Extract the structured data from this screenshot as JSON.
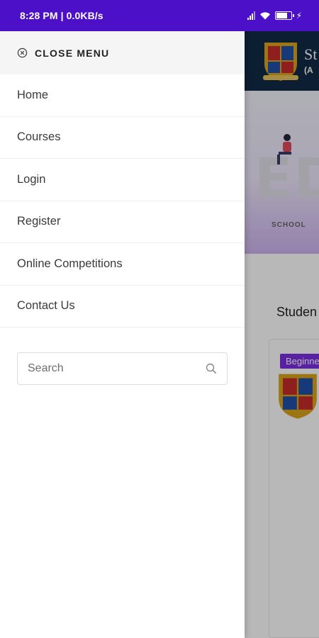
{
  "status_bar": {
    "time_text": "8:28 PM | 0.0KB/s",
    "battery_icon": "battery-charging-icon",
    "signal_icon": "signal-icon",
    "wifi_icon": "wifi-icon"
  },
  "drawer": {
    "close_label": "CLOSE MENU",
    "close_icon": "close-circle-icon",
    "items": [
      {
        "label": "Home"
      },
      {
        "label": "Courses"
      },
      {
        "label": "Login"
      },
      {
        "label": "Register"
      },
      {
        "label": "Online Competitions"
      },
      {
        "label": "Contact Us"
      }
    ],
    "search": {
      "placeholder": "Search",
      "icon": "search-icon"
    }
  },
  "background_page": {
    "brand_text": "St",
    "brand_sub": "(A",
    "banner_letters": "ED",
    "banner_school": "SCHOOL",
    "section_title": "Studen",
    "card_badge": "Beginne"
  },
  "colors": {
    "status_bar": "#4b10c8",
    "header_bg": "#112a44",
    "badge": "#7b2fe0"
  }
}
